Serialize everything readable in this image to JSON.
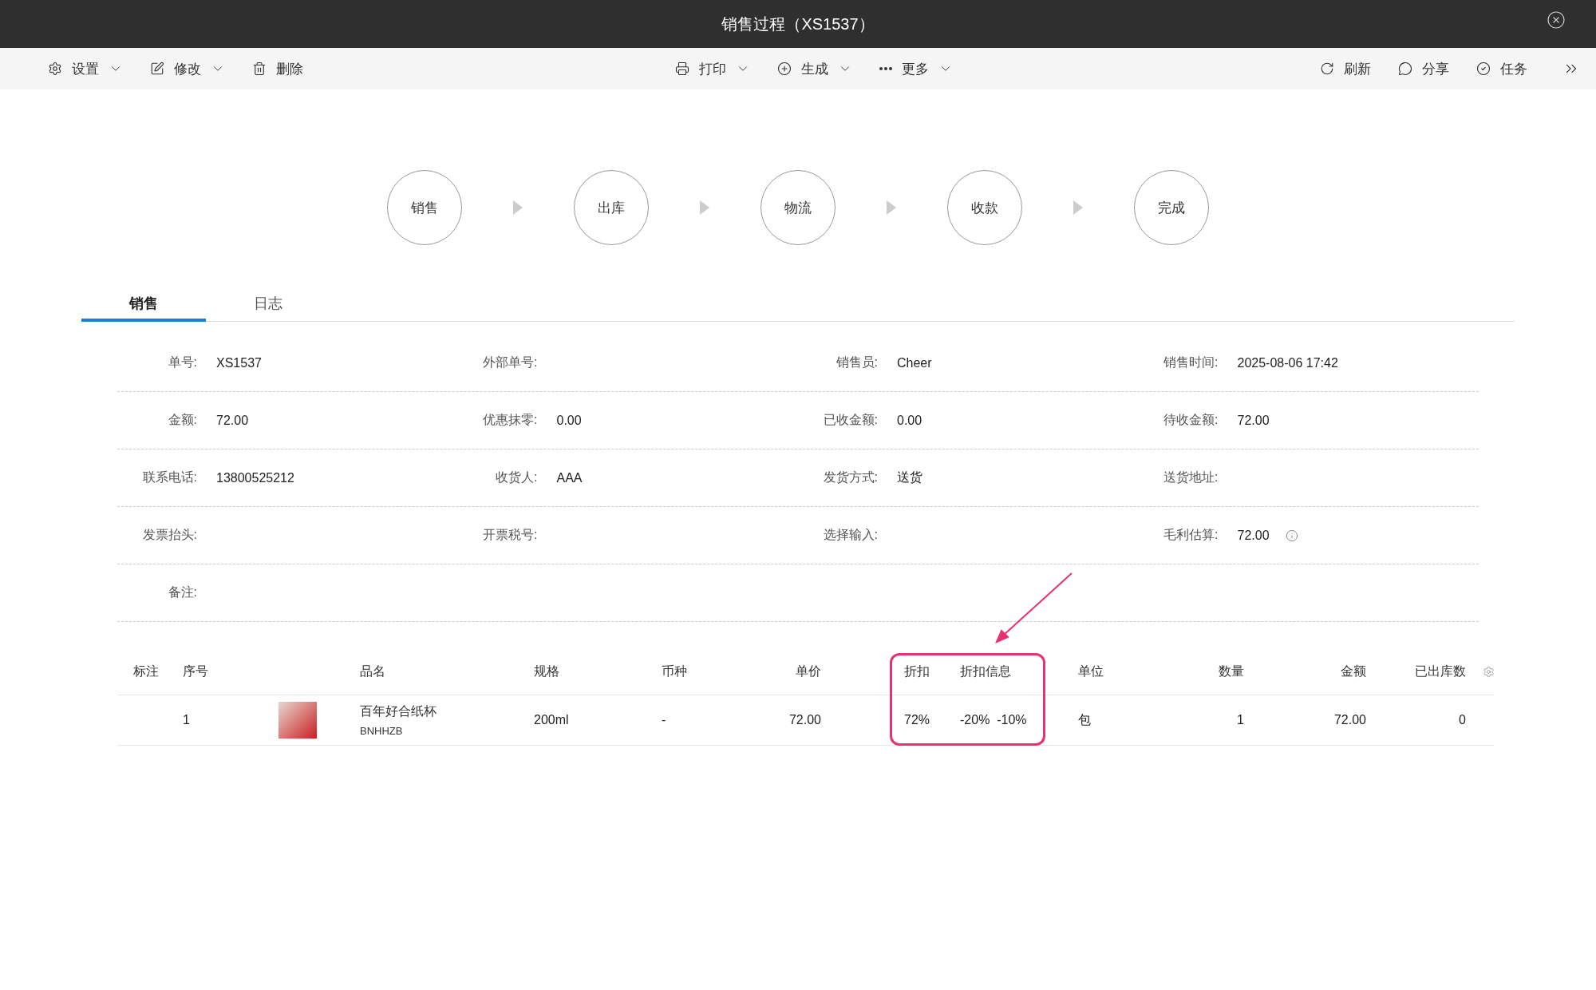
{
  "window": {
    "title": "销售过程（XS1537）"
  },
  "toolbar": {
    "left": [
      {
        "label": "设置",
        "has_menu": true
      },
      {
        "label": "修改",
        "has_menu": true
      },
      {
        "label": "删除",
        "has_menu": false
      }
    ],
    "center": [
      {
        "label": "打印",
        "has_menu": true
      },
      {
        "label": "生成",
        "has_menu": true
      },
      {
        "label": "更多",
        "has_menu": true
      }
    ],
    "right": [
      {
        "label": "刷新"
      },
      {
        "label": "分享"
      },
      {
        "label": "任务"
      }
    ]
  },
  "steps": [
    {
      "label": "销售"
    },
    {
      "label": "出库"
    },
    {
      "label": "物流"
    },
    {
      "label": "收款"
    },
    {
      "label": "完成"
    }
  ],
  "tabs": [
    {
      "label": "销售",
      "selected": true
    },
    {
      "label": "日志",
      "selected": false
    }
  ],
  "fields": [
    [
      {
        "label": "单号:",
        "value": "XS1537"
      },
      {
        "label": "外部单号:"
      },
      {
        "label": "销售员:",
        "value": "Cheer"
      },
      {
        "label": "销售时间:",
        "value": "2025-08-06 17:42"
      }
    ],
    [
      {
        "label": "金额:",
        "value": "72.00"
      },
      {
        "label": "优惠抹零:",
        "value": "0.00"
      },
      {
        "label": "已收金额:",
        "value": "0.00"
      },
      {
        "label": "待收金额:",
        "value": "72.00"
      }
    ],
    [
      {
        "label": "联系电话:",
        "value": "13800525212"
      },
      {
        "label": "收货人:",
        "value": "AAA"
      },
      {
        "label": "发货方式:",
        "value": "送货"
      },
      {
        "label": "送货地址:"
      }
    ],
    [
      {
        "label": "发票抬头:"
      },
      {
        "label": "开票税号:"
      },
      {
        "label": "选择输入:"
      },
      {
        "label": "毛利估算:",
        "value": "72.00",
        "info": true
      }
    ],
    [
      {
        "label": "备注:"
      }
    ]
  ],
  "table": {
    "columns": [
      "标注",
      "序号",
      "",
      "品名",
      "规格",
      "币种",
      "单价",
      "折扣",
      "折扣信息",
      "单位",
      "数量",
      "金额",
      "已出库数"
    ],
    "rows": [
      {
        "index": "1",
        "name": "百年好合纸杯",
        "code": "BNHHZB",
        "spec": "200ml",
        "currency": "-",
        "price": "72.00",
        "discount": "72%",
        "discount_info": "-20%  -10%",
        "unit": "包",
        "quantity": "1",
        "amount": "72.00",
        "shipped": "0"
      }
    ]
  }
}
